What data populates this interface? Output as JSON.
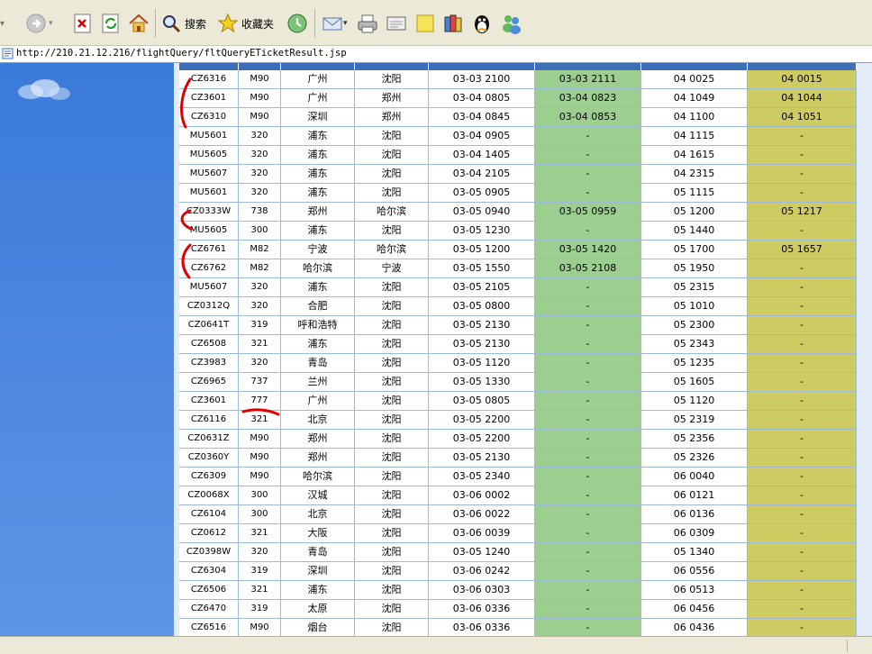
{
  "toolbar": {
    "search_label": "搜索",
    "favorites_label": "收藏夹"
  },
  "address_bar": {
    "url": "http://210.21.12.216/flightQuery/fltQueryETicketResult.jsp"
  },
  "table": {
    "columns": 8,
    "rows": [
      [
        "CZ6316",
        "M90",
        "广州",
        "沈阳",
        "03-03 2100",
        "03-03 2111",
        "04 0025",
        "04 0015"
      ],
      [
        "CZ3601",
        "M90",
        "广州",
        "郑州",
        "03-04 0805",
        "03-04 0823",
        "04 1049",
        "04 1044"
      ],
      [
        "CZ6310",
        "M90",
        "深圳",
        "郑州",
        "03-04 0845",
        "03-04 0853",
        "04 1100",
        "04 1051"
      ],
      [
        "MU5601",
        "320",
        "浦东",
        "沈阳",
        "03-04 0905",
        "-",
        "04 1115",
        "-"
      ],
      [
        "MU5605",
        "320",
        "浦东",
        "沈阳",
        "03-04 1405",
        "-",
        "04 1615",
        "-"
      ],
      [
        "MU5607",
        "320",
        "浦东",
        "沈阳",
        "03-04 2105",
        "-",
        "04 2315",
        "-"
      ],
      [
        "MU5601",
        "320",
        "浦东",
        "沈阳",
        "03-05 0905",
        "-",
        "05 1115",
        "-"
      ],
      [
        "CZ0333W",
        "738",
        "郑州",
        "哈尔滨",
        "03-05 0940",
        "03-05 0959",
        "05 1200",
        "05 1217"
      ],
      [
        "MU5605",
        "300",
        "浦东",
        "沈阳",
        "03-05 1230",
        "-",
        "05 1440",
        "-"
      ],
      [
        "CZ6761",
        "M82",
        "宁波",
        "哈尔滨",
        "03-05 1200",
        "03-05 1420",
        "05 1700",
        "05 1657"
      ],
      [
        "CZ6762",
        "M82",
        "哈尔滨",
        "宁波",
        "03-05 1550",
        "03-05 2108",
        "05 1950",
        "-"
      ],
      [
        "MU5607",
        "320",
        "浦东",
        "沈阳",
        "03-05 2105",
        "-",
        "05 2315",
        "-"
      ],
      [
        "CZ0312Q",
        "320",
        "合肥",
        "沈阳",
        "03-05 0800",
        "-",
        "05 1010",
        "-"
      ],
      [
        "CZ0641T",
        "319",
        "呼和浩特",
        "沈阳",
        "03-05 2130",
        "-",
        "05 2300",
        "-"
      ],
      [
        "CZ6508",
        "321",
        "浦东",
        "沈阳",
        "03-05 2130",
        "-",
        "05 2343",
        "-"
      ],
      [
        "CZ3983",
        "320",
        "青岛",
        "沈阳",
        "03-05 1120",
        "-",
        "05 1235",
        "-"
      ],
      [
        "CZ6965",
        "737",
        "兰州",
        "沈阳",
        "03-05 1330",
        "-",
        "05 1605",
        "-"
      ],
      [
        "CZ3601",
        "777",
        "广州",
        "沈阳",
        "03-05 0805",
        "-",
        "05 1120",
        "-"
      ],
      [
        "CZ6116",
        "321",
        "北京",
        "沈阳",
        "03-05 2200",
        "-",
        "05 2319",
        "-"
      ],
      [
        "CZ0631Z",
        "M90",
        "郑州",
        "沈阳",
        "03-05 2200",
        "-",
        "05 2356",
        "-"
      ],
      [
        "CZ0360Y",
        "M90",
        "郑州",
        "沈阳",
        "03-05 2130",
        "-",
        "05 2326",
        "-"
      ],
      [
        "CZ6309",
        "M90",
        "哈尔滨",
        "沈阳",
        "03-05 2340",
        "-",
        "06 0040",
        "-"
      ],
      [
        "CZ0068X",
        "300",
        "汉城",
        "沈阳",
        "03-06 0002",
        "-",
        "06 0121",
        "-"
      ],
      [
        "CZ6104",
        "300",
        "北京",
        "沈阳",
        "03-06 0022",
        "-",
        "06 0136",
        "-"
      ],
      [
        "CZ0612",
        "321",
        "大阪",
        "沈阳",
        "03-06 0039",
        "-",
        "06 0309",
        "-"
      ],
      [
        "CZ0398W",
        "320",
        "青岛",
        "沈阳",
        "03-05 1240",
        "-",
        "05 1340",
        "-"
      ],
      [
        "CZ6304",
        "319",
        "深圳",
        "沈阳",
        "03-06 0242",
        "-",
        "06 0556",
        "-"
      ],
      [
        "CZ6506",
        "321",
        "浦东",
        "沈阳",
        "03-06 0303",
        "-",
        "06 0513",
        "-"
      ],
      [
        "CZ6470",
        "319",
        "太原",
        "沈阳",
        "03-06 0336",
        "-",
        "06 0456",
        "-"
      ],
      [
        "CZ6516",
        "M90",
        "烟台",
        "沈阳",
        "03-06 0336",
        "-",
        "06 0436",
        "-"
      ]
    ]
  },
  "colors": {
    "actual_departure_col": "#9ccf8f",
    "actual_arrival_col": "#cfcb63",
    "annotation": "#e00000"
  }
}
